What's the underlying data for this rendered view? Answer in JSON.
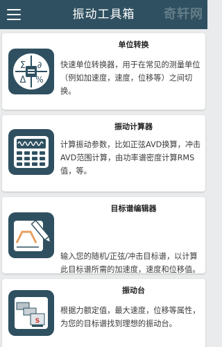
{
  "appbar": {
    "title": "振动工具箱",
    "menu_icon": "hamburger-menu-icon",
    "watermark": "奇轩网"
  },
  "cards": [
    {
      "title": "单位转换",
      "description": "快速单位转换器，用于在常见的测量单位（例如加速度，速度，位移等）之间切换。",
      "icon": "unit-converter-icon",
      "icon_symbols": [
        "Σ",
        "∂",
        "Δ",
        "%"
      ]
    },
    {
      "title": "振动计算器",
      "description": "计算振动参数，比如正弦AVD换算，冲击AVD范围计算，由功率谱密度计算RMS值，等。",
      "icon": "vibration-calculator-icon"
    },
    {
      "title": "目标谱编辑器",
      "description": "输入您的随机/正弦/冲击目标谱，以计算此目标谱所需的加速度，速度和位移值。",
      "icon": "target-spectrum-editor-icon"
    },
    {
      "title": "振动台",
      "description": "根据力额定值，最大速度，位移等属性，为您的目标谱找到理想的振动台。",
      "icon": "shaker-table-icon"
    }
  ],
  "colors": {
    "appbar": "#2f5060",
    "background": "#e9ebec",
    "card": "#ffffff",
    "accent_orange": "#e8a060"
  }
}
